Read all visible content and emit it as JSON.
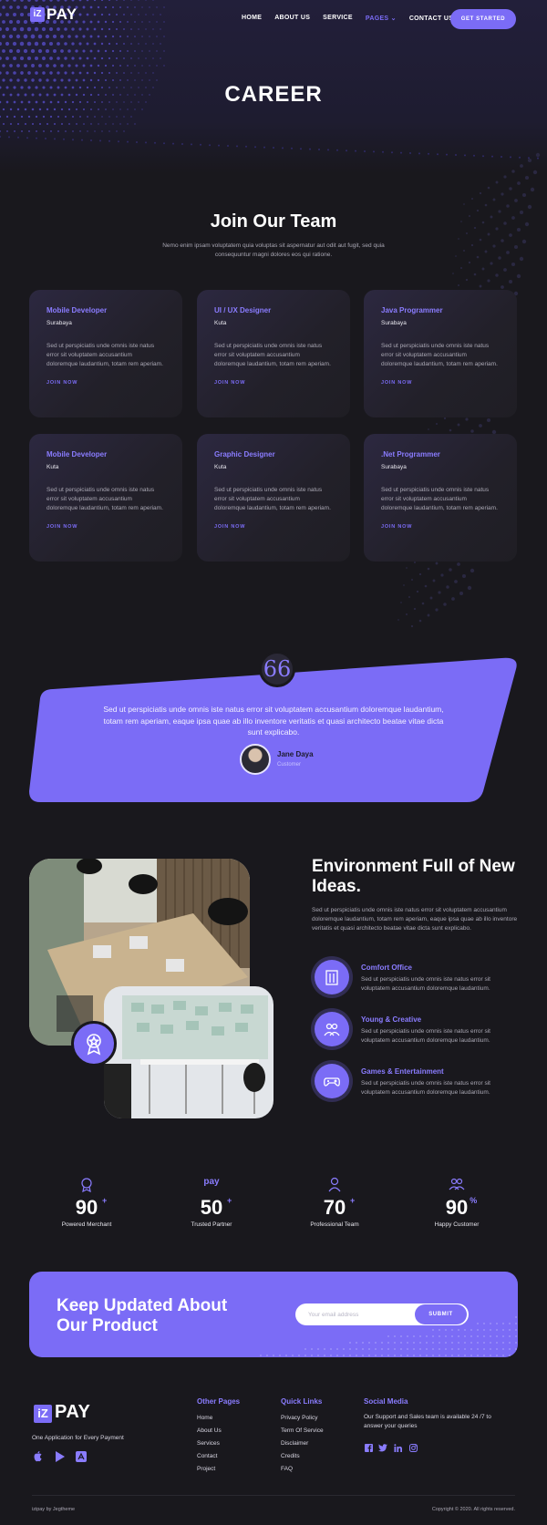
{
  "brand": {
    "logo_letter": "iZ",
    "logo_text": "PAY"
  },
  "nav": {
    "items": [
      "HOME",
      "ABOUT US",
      "SERVICE",
      "PAGES",
      "CONTACT US"
    ],
    "cta": "GET STARTED"
  },
  "hero": {
    "title": "CAREER"
  },
  "join": {
    "title": "Join Our Team",
    "subtitle": "Nemo enim ipsam voluptatem quia voluptas sit aspernatur aut odit aut fugit, sed quia consequuntur magni dolores eos qui ratione.",
    "jobs": [
      {
        "title": "Mobile Developer",
        "location": "Surabaya",
        "desc": "Sed ut perspiciatis unde omnis iste natus error sit voluptatem accusantium doloremque laudantium, totam rem aperiam.",
        "cta": "JOIN NOW"
      },
      {
        "title": "UI / UX Designer",
        "location": "Kuta",
        "desc": "Sed ut perspiciatis unde omnis iste natus error sit voluptatem accusantium doloremque laudantium, totam rem aperiam.",
        "cta": "JOIN NOW"
      },
      {
        "title": "Java Programmer",
        "location": "Surabaya",
        "desc": "Sed ut perspiciatis unde omnis iste natus error sit voluptatem accusantium doloremque laudantium, totam rem aperiam.",
        "cta": "JOIN NOW"
      },
      {
        "title": "Mobile Developer",
        "location": "Kuta",
        "desc": "Sed ut perspiciatis unde omnis iste natus error sit voluptatem accusantium doloremque laudantium, totam rem aperiam.",
        "cta": "JOIN NOW"
      },
      {
        "title": "Graphic Designer",
        "location": "Kuta",
        "desc": "Sed ut perspiciatis unde omnis iste natus error sit voluptatem accusantium doloremque laudantium, totam rem aperiam.",
        "cta": "JOIN NOW"
      },
      {
        "title": ".Net Programmer",
        "location": "Surabaya",
        "desc": "Sed ut perspiciatis unde omnis iste natus error sit voluptatem accusantium doloremque laudantium, totam rem aperiam.",
        "cta": "JOIN NOW"
      }
    ]
  },
  "testimonial": {
    "quote_mark": "66",
    "text": "Sed ut perspiciatis unde omnis iste natus error sit voluptatem accusantium doloremque laudantium, totam rem aperiam, eaque ipsa quae ab illo inventore veritatis et quasi architecto beatae vitae dicta sunt explicabo.",
    "name": "Jane Daya",
    "role": "Customer"
  },
  "environment": {
    "title": "Environment Full of New Ideas.",
    "desc": "Sed ut perspiciatis unde omnis iste natus error sit voluptatem accusantium doloremque laudantium, totam rem aperiam, eaque ipsa quae ab illo inventore veritatis et quasi architecto beatae vitae dicta sunt explicabo.",
    "features": [
      {
        "title": "Comfort Office",
        "desc": "Sed ut perspiciatis unde omnis iste natus error sit voluptatem accusantium doloremque laudantium."
      },
      {
        "title": "Young & Creative",
        "desc": "Sed ut perspiciatis unde omnis iste natus error sit voluptatem accusantium doloremque laudantium."
      },
      {
        "title": "Games & Entertainment",
        "desc": "Sed ut perspiciatis unde omnis iste natus error sit voluptatem accusantium doloremque laudantium."
      }
    ]
  },
  "stats": [
    {
      "value": "90",
      "suffix": "+",
      "label": "Powered Merchant"
    },
    {
      "value": "50",
      "suffix": "+",
      "label": "Trusted Partner"
    },
    {
      "value": "70",
      "suffix": "+",
      "label": "Professional Team"
    },
    {
      "value": "90",
      "suffix": "%",
      "label": "Happy Customer"
    }
  ],
  "stats_icon_text": "pay",
  "newsletter": {
    "title": "Keep Updated About Our Product",
    "placeholder": "Your email address",
    "button": "SUBMIT"
  },
  "footer": {
    "tagline": "One Application for Every Payment",
    "other_pages": {
      "title": "Other Pages",
      "links": [
        "Home",
        "About Us",
        "Services",
        "Contact",
        "Project"
      ]
    },
    "quick_links": {
      "title": "Quick Links",
      "links": [
        "Privacy Policy",
        "Term Of Service",
        "Disclaimer",
        "Credits",
        "FAQ"
      ]
    },
    "social": {
      "title": "Social Media",
      "text": "Our Support and Sales team is available 24 /7 to answer your queries"
    },
    "credit": "izipay by Jegtheme",
    "copyright": "Copyright © 2020. All rights reserved."
  },
  "colors": {
    "accent": "#7b6cf6",
    "background": "#19181d",
    "card": "#222029"
  }
}
